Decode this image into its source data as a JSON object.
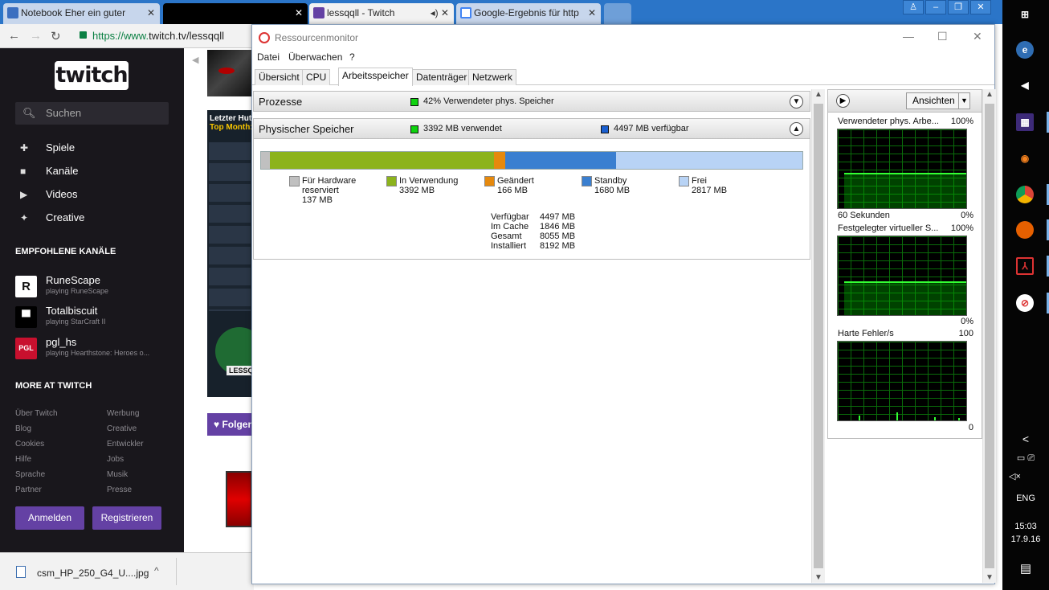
{
  "browser": {
    "tabs": [
      {
        "title": "Notebook Eher ein guter"
      },
      {
        "title": ""
      },
      {
        "title": "lessqqll - Twitch"
      },
      {
        "title": "Google-Ergebnis für http"
      }
    ],
    "url_scheme": "https://www.",
    "url_host": "twitch.tv/lessqqll",
    "download": {
      "filename": "csm_HP_250_G4_U....jpg"
    }
  },
  "twitch": {
    "logo": "twitch",
    "search_placeholder": "Suchen",
    "nav": [
      {
        "label": "Spiele",
        "icon": "puzzle-icon"
      },
      {
        "label": "Kanäle",
        "icon": "camera-icon"
      },
      {
        "label": "Videos",
        "icon": "play-icon"
      },
      {
        "label": "Creative",
        "icon": "sparkle-icon"
      }
    ],
    "recommended_header": "EMPFOHLENE KANÄLE",
    "channels": [
      {
        "name": "RuneScape",
        "game": "playing RuneScape"
      },
      {
        "name": "Totalbiscuit",
        "game": "playing StarCraft II"
      },
      {
        "name": "pgl_hs",
        "game": "playing Hearthstone: Heroes o..."
      }
    ],
    "more_header": "MORE AT TWITCH",
    "links_left": [
      "Über Twitch",
      "Blog",
      "Cookies",
      "Hilfe",
      "Sprache",
      "Partner"
    ],
    "links_right": [
      "Werbung",
      "Creative",
      "Entwickler",
      "Jobs",
      "Musik",
      "Presse"
    ],
    "login": "Anmelden",
    "register": "Registrieren",
    "panel_title": "Letzter Hut",
    "panel_sub": "Top Month:",
    "panel_badge": "LESSQ",
    "follow": "Folgen"
  },
  "resmon": {
    "title": "Ressourcenmonitor",
    "menu": [
      "Datei",
      "Überwachen",
      "?"
    ],
    "tabs": [
      "Übersicht",
      "CPU",
      "Arbeitsspeicher",
      "Datenträger",
      "Netzwerk"
    ],
    "active_tab": "Arbeitsspeicher",
    "processes": {
      "label": "Prozesse",
      "summary": "42% Verwendeter phys. Speicher"
    },
    "physical": {
      "label": "Physischer Speicher",
      "used": "3392 MB verwendet",
      "available": "4497 MB verfügbar"
    },
    "bar": [
      {
        "name": "Für Hardware reserviert",
        "mb": 137,
        "color": "#c0c0c0"
      },
      {
        "name": "In Verwendung",
        "mb": 3392,
        "color": "#8cb31c"
      },
      {
        "name": "Geändert",
        "mb": 166,
        "color": "#e6890d"
      },
      {
        "name": "Standby",
        "mb": 1680,
        "color": "#3a7fd0"
      },
      {
        "name": "Frei",
        "mb": 2817,
        "color": "#b8d3f5"
      }
    ],
    "legend": [
      {
        "l1": "Für Hardware",
        "l2": "reserviert",
        "v": "137 MB",
        "color": "#c0c0c0"
      },
      {
        "l1": "In Verwendung",
        "v": "3392 MB",
        "color": "#8cb31c"
      },
      {
        "l1": "Geändert",
        "v": "166 MB",
        "color": "#e6890d"
      },
      {
        "l1": "Standby",
        "v": "1680 MB",
        "color": "#3a7fd0"
      },
      {
        "l1": "Frei",
        "v": "2817 MB",
        "color": "#b8d3f5"
      }
    ],
    "stats": [
      {
        "k": "Verfügbar",
        "v": "4497 MB"
      },
      {
        "k": "Im Cache",
        "v": "1846 MB"
      },
      {
        "k": "Gesamt",
        "v": "8055 MB"
      },
      {
        "k": "Installiert",
        "v": "8192 MB"
      }
    ],
    "views_button": "Ansichten",
    "graphs": [
      {
        "title": "Verwendeter phys. Arbe...",
        "max": "100%",
        "foot_left": "60 Sekunden",
        "foot_right": "0%",
        "level": 0.45
      },
      {
        "title": "Festgelegter virtueller S...",
        "max": "100%",
        "foot_left": "",
        "foot_right": "0%",
        "level": 0.43
      },
      {
        "title": "Harte Fehler/s",
        "max": "100",
        "foot_left": "",
        "foot_right": "0",
        "level": 0
      }
    ]
  },
  "taskbar": {
    "lang": "ENG",
    "time": "15:03",
    "date": "17.9.16"
  },
  "colors": {
    "twitch_purple": "#6441a4",
    "graph_green": "#33ff33"
  }
}
